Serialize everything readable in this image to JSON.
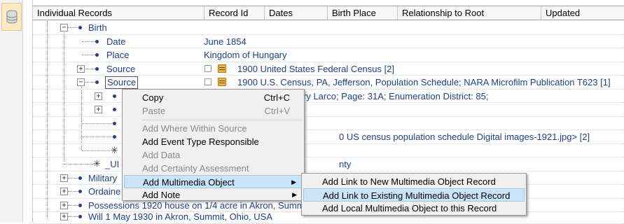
{
  "columns": [
    {
      "label": "Individual Records"
    },
    {
      "label": "Record Id"
    },
    {
      "label": "Dates"
    },
    {
      "label": "Birth Place"
    },
    {
      "label": "Relationship to Root"
    },
    {
      "label": "Updated"
    }
  ],
  "rows": [
    {
      "label": "Birth",
      "value": ""
    },
    {
      "label": "Date",
      "value": "June 1854"
    },
    {
      "label": "Place",
      "value": "Kingdom of Hungary"
    },
    {
      "label": "Source",
      "value": "1900 United States Federal Census [2]"
    },
    {
      "label": "Source",
      "value": "1900 U.S. Census, PA, Jefferson, Population Schedule; NARA Microfilm Publication T623 [1]"
    },
    {
      "label": "",
      "value": "ry Larco; Page: 31A; Enumeration District: 85;"
    },
    {
      "label": "",
      "value": ""
    },
    {
      "label": "",
      "value": ""
    },
    {
      "label": "",
      "value": "0 US census population schedule Digital images-1921.jpg> [2]"
    },
    {
      "label": "",
      "value": ""
    },
    {
      "label": "_UI",
      "value": "nty"
    },
    {
      "label": "Military",
      "value": ""
    },
    {
      "label": "Ordaine",
      "value": ""
    },
    {
      "label": "Possessions 1920 house on 1/4 acre in Akron, Summ",
      "value": ""
    },
    {
      "label": "Will 1 May 1930 in Akron, Summit, Ohio, USA",
      "value": ""
    }
  ],
  "context_menu": {
    "items": [
      {
        "label": "Copy",
        "shortcut": "Ctrl+C",
        "enabled": true
      },
      {
        "label": "Paste",
        "shortcut": "Ctrl+V",
        "enabled": false
      },
      {
        "label": "Add Where Within Source",
        "enabled": false
      },
      {
        "label": "Add Event Type Responsible",
        "enabled": true
      },
      {
        "label": "Add Data",
        "enabled": false
      },
      {
        "label": "Add Certainty Assessment",
        "enabled": false
      },
      {
        "label": "Add Multimedia Object",
        "enabled": true,
        "highlighted": true,
        "submenu": true
      },
      {
        "label": "Add Note",
        "enabled": true,
        "submenu": true
      }
    ]
  },
  "submenu": {
    "items": [
      {
        "label": "Add Link to New Multimedia Object Record"
      },
      {
        "label": "Add Link to Existing Multimedia Object Record",
        "highlighted": true
      },
      {
        "label": "Add Local Multimedia Object to this Record"
      }
    ]
  },
  "icons": {
    "sidebar": "database-icon",
    "expander": "tree-expander-icon",
    "source": "source-citation-icon",
    "submenu_arrow": "submenu-arrow-icon"
  },
  "colors": {
    "link_text": "#1f3f8f",
    "highlight": "#cce4f7",
    "highlight_border": "#99c9ef",
    "sidebar_button": "#fde9c4"
  }
}
